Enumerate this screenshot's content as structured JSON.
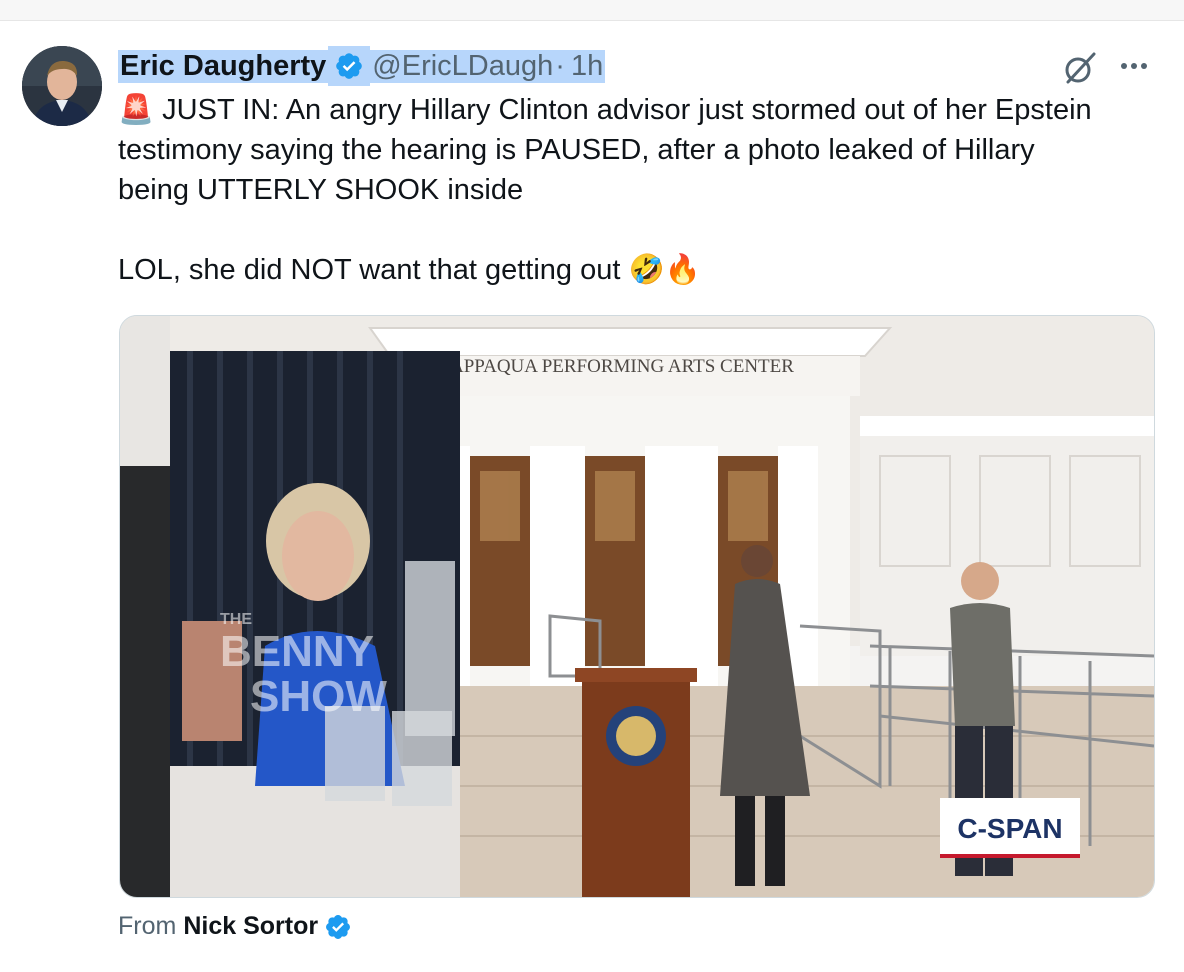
{
  "tweet": {
    "author_name": "Eric Daugherty",
    "handle": "@EricLDaugh",
    "separator": "·",
    "time": "1h",
    "text_line1": "JUST IN: An angry Hillary Clinton advisor just stormed out of her Epstein",
    "text_line2": "testimony saying the hearing is PAUSED, after a photo leaked of Hillary",
    "text_line3": "being UTTERLY SHOOK inside",
    "text_line4": "LOL, she did NOT want that getting out",
    "emoji_alarm": "🚨",
    "emoji_laugh": "🤣",
    "emoji_fire": "🔥"
  },
  "media": {
    "building_sign": "APPAQUA PERFORMING ARTS CENTER",
    "watermark_line1": "THE",
    "watermark_line2": "BENNY",
    "watermark_line3": "SHOW",
    "cspan_label": "C-SPAN"
  },
  "attribution": {
    "prefix": "From",
    "name": "Nick Sortor"
  },
  "colors": {
    "verified_blue": "#1d9bf0",
    "selection_highlight": "#b7d6fb",
    "secondary_text": "#536471"
  }
}
